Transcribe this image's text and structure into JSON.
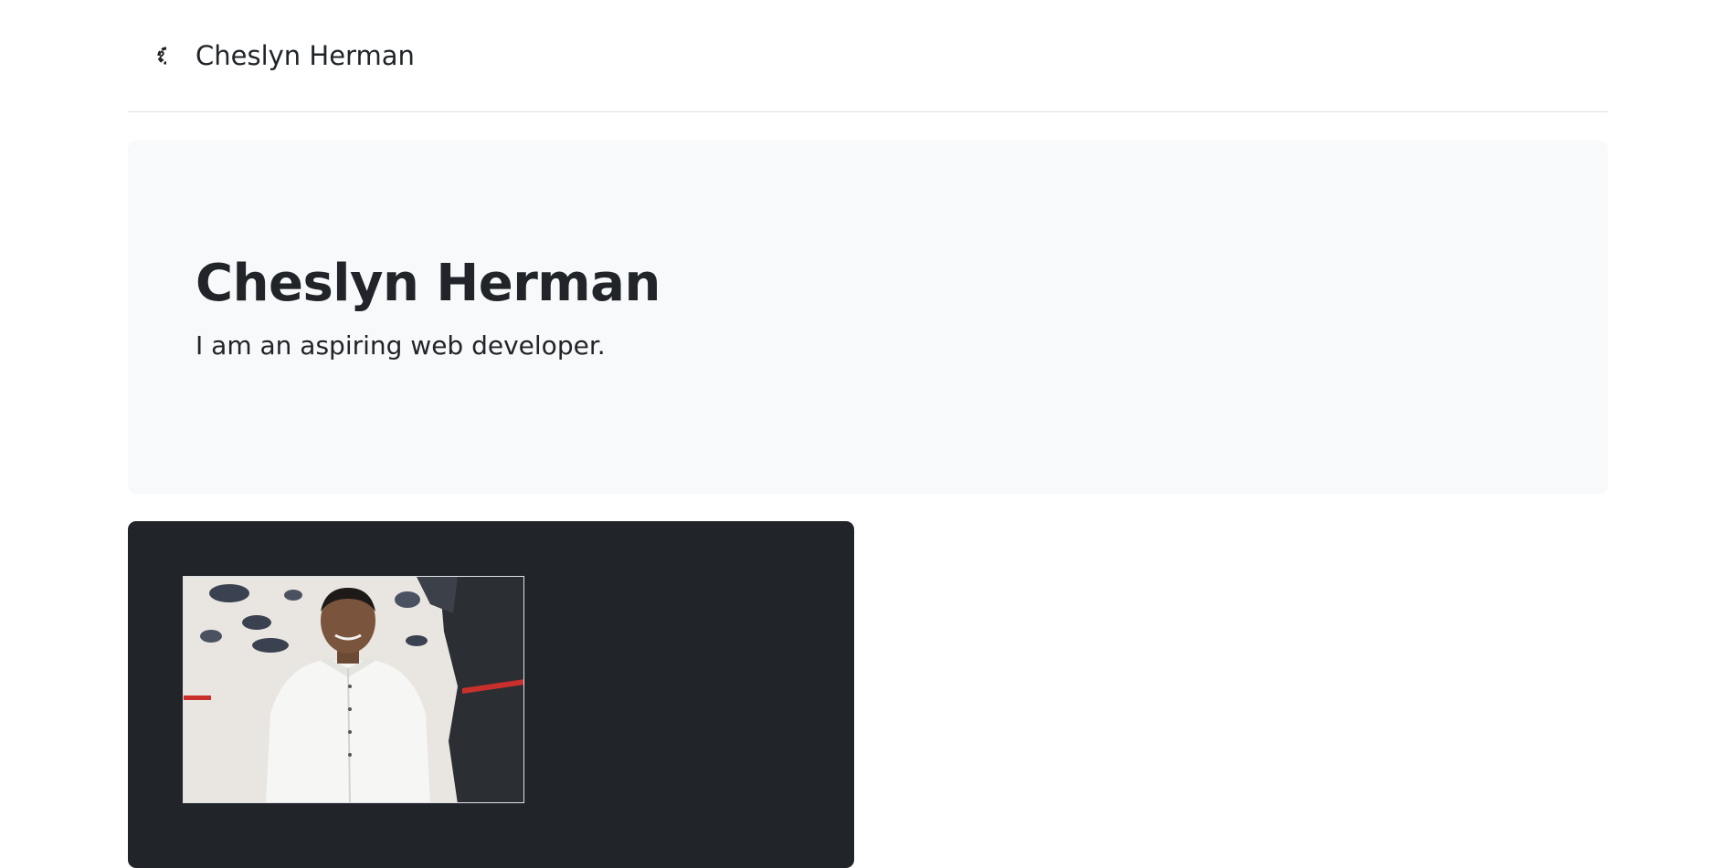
{
  "header": {
    "brand_icon": "brand-logo-icon",
    "brand_name": "Cheslyn Herman"
  },
  "hero": {
    "title": "Cheslyn Herman",
    "subtitle": "I am an aspiring web developer."
  },
  "profile": {
    "photo_icon": "portrait-photo"
  },
  "colors": {
    "hero_background": "#f8f9fa",
    "card_background": "#212529",
    "text": "#212529",
    "divider": "#dee2e6"
  }
}
